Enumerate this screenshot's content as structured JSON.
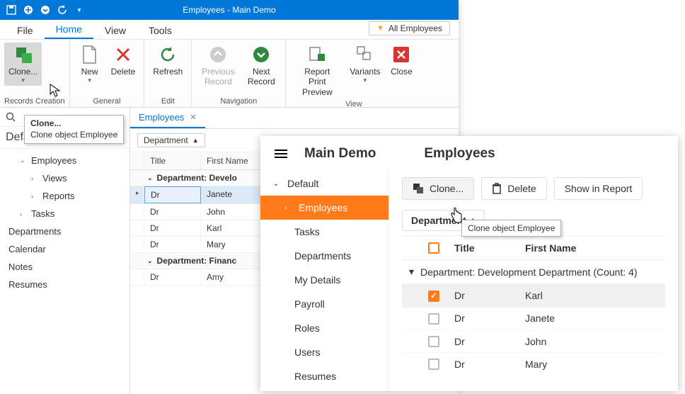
{
  "titlebar": {
    "title": "Employees - Main Demo"
  },
  "menubar": {
    "file": "File",
    "home": "Home",
    "view": "View",
    "tools": "Tools",
    "filter_label": "All Employees"
  },
  "ribbon": {
    "clone": "Clone...",
    "new": "New",
    "delete": "Delete",
    "refresh": "Refresh",
    "prev": "Previous Record",
    "next": "Next Record",
    "report": "Report Print Preview",
    "variants": "Variants",
    "close": "Close",
    "g_records": "Records Creation",
    "g_general": "General",
    "g_edit": "Edit",
    "g_nav": "Navigation",
    "g_view": "View"
  },
  "nav": {
    "header": "Default",
    "items": {
      "employees": "Employees",
      "views": "Views",
      "reports": "Reports",
      "tasks": "Tasks",
      "departments": "Departments",
      "calendar": "Calendar",
      "notes": "Notes",
      "resumes": "Resumes"
    }
  },
  "tabs": {
    "employees": "Employees"
  },
  "grid": {
    "group_by": "Department",
    "col_title": "Title",
    "col_first": "First Name",
    "group1": "Department: Develo",
    "group2": "Department: Financ",
    "rows1": [
      {
        "title": "Dr",
        "first": "Janete"
      },
      {
        "title": "Dr",
        "first": "John"
      },
      {
        "title": "Dr",
        "first": "Karl"
      },
      {
        "title": "Dr",
        "first": "Mary"
      }
    ],
    "rows2": [
      {
        "title": "Dr",
        "first": "Amy"
      }
    ]
  },
  "tooltip": {
    "title": "Clone...",
    "body": "Clone object Employee"
  },
  "web": {
    "brand": "Main Demo",
    "heading": "Employees",
    "nav": {
      "default": "Default",
      "employees": "Employees",
      "tasks": "Tasks",
      "departments": "Departments",
      "mydetails": "My Details",
      "payroll": "Payroll",
      "roles": "Roles",
      "users": "Users",
      "resumes": "Resumes"
    },
    "actions": {
      "clone": "Clone...",
      "delete": "Delete",
      "show": "Show in Report"
    },
    "sort_chip": "Department",
    "cols": {
      "title": "Title",
      "first": "First Name"
    },
    "group_row": "Department: Development Department (Count: 4)",
    "rows": [
      {
        "title": "Dr",
        "first": "Karl",
        "sel": true
      },
      {
        "title": "Dr",
        "first": "Janete",
        "sel": false
      },
      {
        "title": "Dr",
        "first": "John",
        "sel": false
      },
      {
        "title": "Dr",
        "first": "Mary",
        "sel": false
      }
    ],
    "tooltip": "Clone object Employee"
  }
}
